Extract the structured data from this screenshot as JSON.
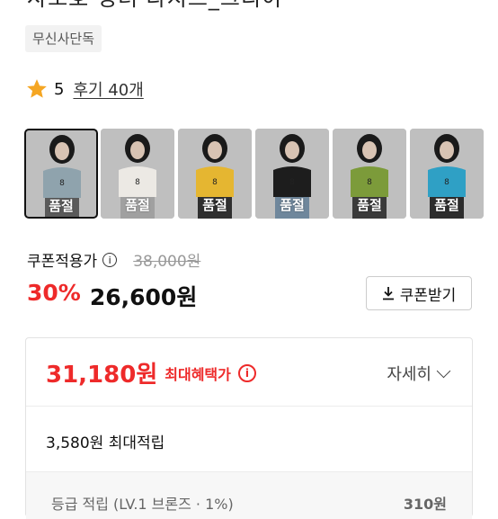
{
  "product": {
    "title_partial": "사소호 킹녀 라지즈_크리이",
    "exclusive_badge": "무신사단독"
  },
  "rating": {
    "score": "5",
    "reviews_label": "후기 40개"
  },
  "variants": [
    {
      "label": "품절",
      "shirt_color": "#8fa3ad",
      "pants_color": "#5a5a5a",
      "selected": true
    },
    {
      "label": "품절",
      "shirt_color": "#ece9e4",
      "pants_color": "#a0a0a0",
      "selected": false
    },
    {
      "label": "품절",
      "shirt_color": "#e5b631",
      "pants_color": "#2f2f2f",
      "selected": false
    },
    {
      "label": "품절",
      "shirt_color": "#1d1d1d",
      "pants_color": "#6f879c",
      "selected": false
    },
    {
      "label": "품절",
      "shirt_color": "#7c9b3a",
      "pants_color": "#3a3a3a",
      "selected": false
    },
    {
      "label": "품절",
      "shirt_color": "#2fa0c5",
      "pants_color": "#2c2c2c",
      "selected": false
    }
  ],
  "pricing": {
    "coupon_price_label": "쿠폰적용가",
    "original_price": "38,000원",
    "discount": "30%",
    "price": "26,600원",
    "coupon_button": "쿠폰받기"
  },
  "benefit": {
    "max_price": "31,180원",
    "max_label": "최대혜택가",
    "detail_label": "자세히",
    "points": "3,580원 최대적립",
    "sub_label": "등급 적립 (LV.1 브론즈 · 1%)",
    "sub_amount": "310원"
  },
  "colors": {
    "accent_red": "#ee2a2a",
    "star": "#f5a623"
  }
}
